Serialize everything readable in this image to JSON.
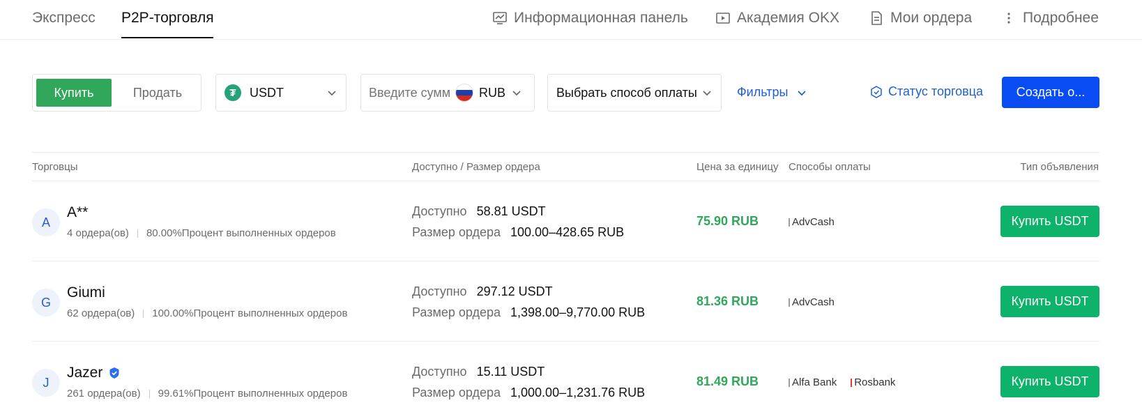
{
  "nav": {
    "tabs": [
      {
        "label": "Экспресс"
      },
      {
        "label": "P2P-торговля"
      }
    ],
    "links": [
      {
        "label": "Информационная панель",
        "icon": "dashboard-icon"
      },
      {
        "label": "Академия OKX",
        "icon": "play-video-icon"
      },
      {
        "label": "Мои ордера",
        "icon": "document-icon"
      },
      {
        "label": "Подробнее",
        "icon": "more-vertical-icon"
      }
    ]
  },
  "controls": {
    "buy_label": "Купить",
    "sell_label": "Продать",
    "crypto": {
      "symbol": "USDT",
      "icon": "tether-icon",
      "icon_glyph": "₮"
    },
    "amount": {
      "placeholder": "Введите сумм",
      "currency": "RUB",
      "flag": "russia-flag-icon"
    },
    "payment_method_label": "Выбрать способ оплаты",
    "filters_label": "Фильтры",
    "merchant_status_label": "Статус торговца",
    "create_label": "Создать о..."
  },
  "table": {
    "headers": {
      "merchants": "Торговцы",
      "available": "Доступно / Размер ордера",
      "price": "Цена за единицу",
      "payment": "Способы оплаты",
      "ad_type": "Тип объявления"
    },
    "rows": [
      {
        "avatar": "A",
        "name": "A**",
        "verified": false,
        "orders": "4 ордера(ов)",
        "completion": "80.00%Процент выполненных ордеров",
        "available_label": "Доступно",
        "available": "58.81 USDT",
        "limit_label": "Размер ордера",
        "limit": "100.00–428.65 RUB",
        "price": "75.90 RUB",
        "payments": [
          {
            "label": "AdvCash",
            "color": "#9e9e9e"
          }
        ],
        "action": "Купить USDT"
      },
      {
        "avatar": "G",
        "name": "Giumi",
        "verified": false,
        "orders": "62 ордера(ов)",
        "completion": "100.00%Процент выполненных ордеров",
        "available_label": "Доступно",
        "available": "297.12 USDT",
        "limit_label": "Размер ордера",
        "limit": "1,398.00–9,770.00 RUB",
        "price": "81.36 RUB",
        "payments": [
          {
            "label": "AdvCash",
            "color": "#9e9e9e"
          }
        ],
        "action": "Купить USDT"
      },
      {
        "avatar": "J",
        "name": "Jazer",
        "verified": true,
        "orders": "261 ордера(ов)",
        "completion": "99.61%Процент выполненных ордеров",
        "available_label": "Доступно",
        "available": "15.11 USDT",
        "limit_label": "Размер ордера",
        "limit": "1,000.00–1,231.76 RUB",
        "price": "81.49 RUB",
        "payments": [
          {
            "label": "Alfa Bank",
            "color": "#9e9e9e"
          },
          {
            "label": "Rosbank",
            "color": "#e53935"
          }
        ],
        "action": "Купить USDT"
      }
    ]
  },
  "colors": {
    "accent_green": "#31a75c",
    "buy_button": "#0db26b",
    "primary_blue": "#0a4cf3",
    "link_blue": "#1f5fd6"
  }
}
